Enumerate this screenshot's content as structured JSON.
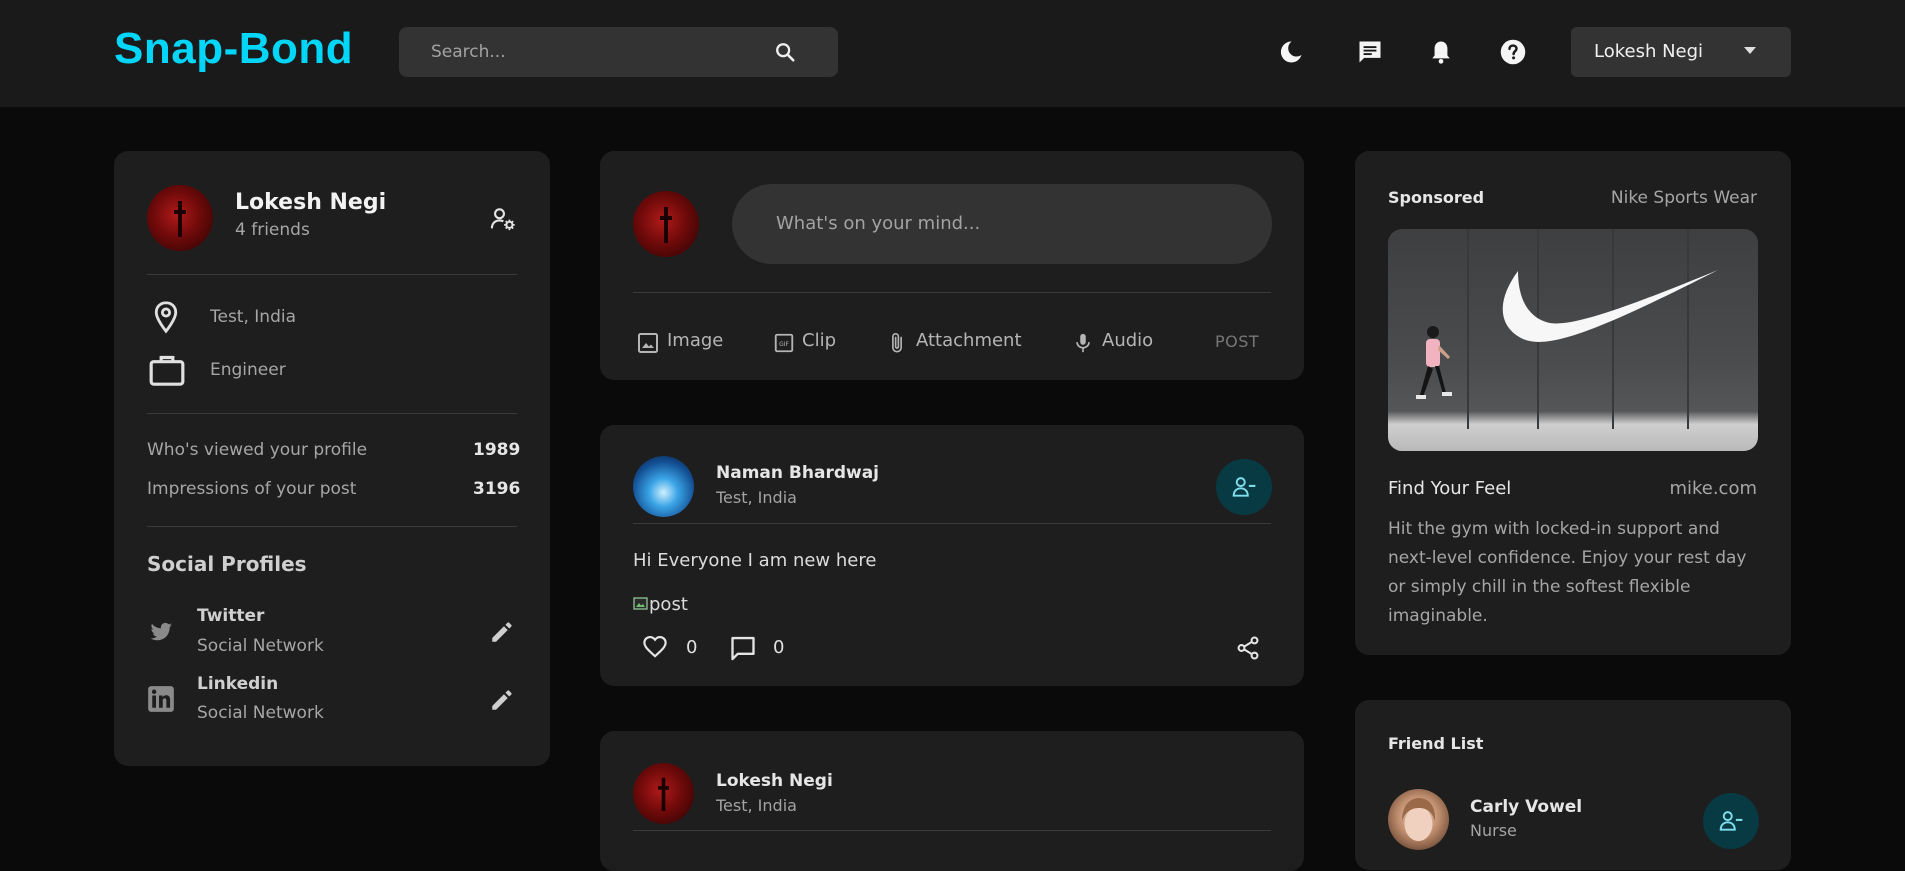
{
  "navbar": {
    "logo": "Snap-Bond",
    "search": {
      "placeholder": "Search..."
    },
    "icons": [
      "dark-mode-icon",
      "message-icon",
      "notification-icon",
      "help-icon"
    ],
    "user_select": "Lokesh Negi"
  },
  "profile": {
    "name": "Lokesh Negi",
    "friends": "4 friends",
    "location": "Test, India",
    "occupation": "Engineer",
    "stats": [
      {
        "label": "Who's viewed your profile",
        "value": "1989"
      },
      {
        "label": "Impressions of your post",
        "value": "3196"
      }
    ],
    "social_title": "Social Profiles",
    "social": [
      {
        "name": "Twitter",
        "type": "Social Network",
        "icon": "twitter-icon"
      },
      {
        "name": "Linkedin",
        "type": "Social Network",
        "icon": "linkedin-icon"
      }
    ]
  },
  "composer": {
    "placeholder": "What's on your mind...",
    "actions": [
      "Image",
      "Clip",
      "Attachment",
      "Audio"
    ],
    "post": "POST"
  },
  "posts": [
    {
      "author": "Naman Bhardwaj",
      "location": "Test, India",
      "text": "Hi Everyone I am new here",
      "image_alt": "post",
      "likes": "0",
      "comments": "0"
    },
    {
      "author": "Lokesh Negi",
      "location": "Test, India"
    }
  ],
  "sponsored": {
    "label": "Sponsored",
    "brand": "Nike Sports Wear",
    "headline": "Find Your Feel",
    "site": "mike.com",
    "description": "Hit the gym with locked-in support and next-level confidence. Enjoy your rest day or simply chill in the softest flexible imaginable."
  },
  "friend_list": {
    "title": "Friend List",
    "friends": [
      {
        "name": "Carly Vowel",
        "occupation": "Nurse"
      }
    ]
  },
  "colors": {
    "brand": "#00d5fa",
    "background": "#0a0a0a",
    "card": "#1e1e1e",
    "friend_button": "#083a44",
    "friend_icon": "#7fdfee"
  }
}
